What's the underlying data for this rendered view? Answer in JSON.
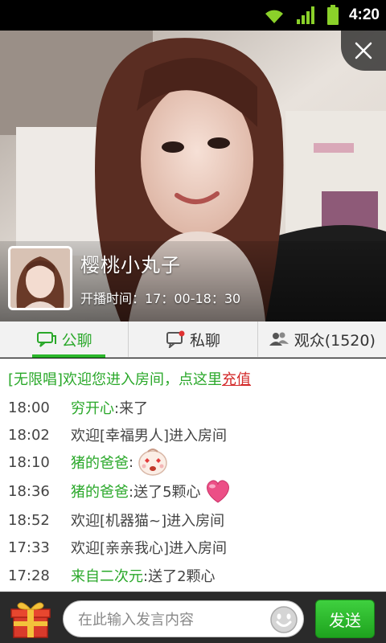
{
  "status_bar": {
    "time": "4:20",
    "icons": [
      "wifi-icon",
      "signal-icon",
      "battery-icon"
    ]
  },
  "hero": {
    "anchor_name": "樱桃小丸子",
    "schedule": "开播时间：17：00-18：30",
    "close_icon": "close-icon"
  },
  "tabs": [
    {
      "label": "公聊",
      "icon": "chat-bubble-icon",
      "active": true
    },
    {
      "label": "私聊",
      "icon": "private-chat-icon",
      "active": false
    },
    {
      "label": "观众(1520)",
      "icon": "audience-icon",
      "active": false
    }
  ],
  "chat": {
    "notice_prefix": "[无限唱]欢迎您进入房间，点这里",
    "notice_link": "充值",
    "messages": [
      {
        "time": "18:00",
        "user": "穷开心",
        "text": ":来了"
      },
      {
        "time": "18:02",
        "user": "",
        "text": "欢迎[幸福男人]进入房间"
      },
      {
        "time": "18:10",
        "user": "猪的爸爸",
        "text": ":",
        "emoji": "baby-face-emoji"
      },
      {
        "time": "18:36",
        "user": "猪的爸爸",
        "text": ":送了5颗心",
        "emoji": "heart-icon"
      },
      {
        "time": "18:52",
        "user": "",
        "text": "欢迎[机器猫~]进入房间"
      },
      {
        "time": "17:33",
        "user": "",
        "text": "欢迎[亲亲我心]进入房间"
      },
      {
        "time": "17:28",
        "user": "来自二次元",
        "text": ":送了2颗心"
      }
    ]
  },
  "composer": {
    "placeholder": "在此输入发言内容",
    "send_label": "发送",
    "gift_icon": "gift-icon",
    "emoji_icon": "smiley-icon"
  },
  "colors": {
    "accent_green": "#2aa82a",
    "link_red": "#d32b2b",
    "bar_dark": "#2a2a2a"
  }
}
